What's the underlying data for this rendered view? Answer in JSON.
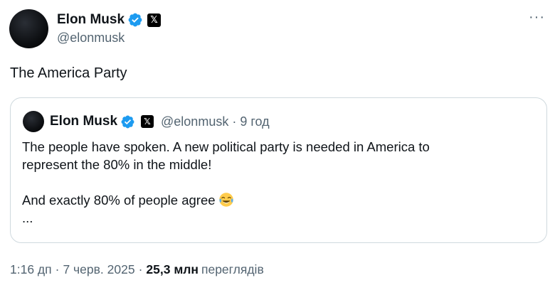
{
  "author": {
    "name": "Elon Musk",
    "handle": "@elonmusk"
  },
  "tweet": {
    "text": "The America Party"
  },
  "quote": {
    "name": "Elon Musk",
    "handle": "@elonmusk",
    "dot": "·",
    "time": "9 год",
    "line1": "The people have spoken. A new political party is needed in America to",
    "line2": "represent the 80% in the middle!",
    "line3": "And exactly 80% of people agree",
    "ellipsis": "..."
  },
  "meta": {
    "time": "1:16 дп",
    "sep1": "·",
    "date": "7 черв. 2025",
    "sep2": "·",
    "views_count": "25,3 млн",
    "views_label": "переглядів"
  },
  "icons": {
    "verified": "verified-badge-icon",
    "x_badge": "x-logo-icon",
    "more": "more-options-icon",
    "emoji": "tears-of-joy-emoji"
  },
  "colors": {
    "verified_blue": "#1d9bf0",
    "secondary_text": "#536471",
    "border": "#cfd9de"
  }
}
